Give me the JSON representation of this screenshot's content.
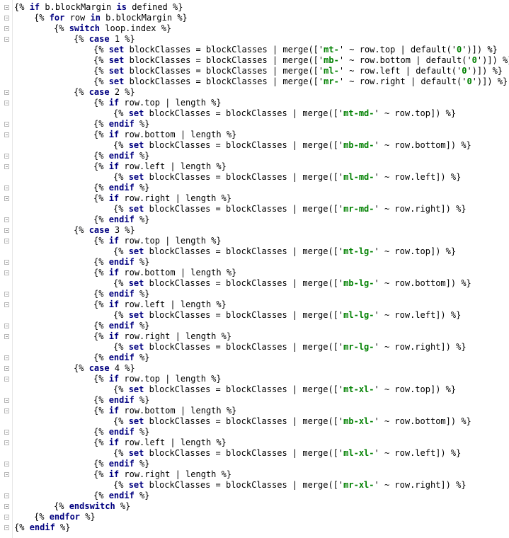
{
  "editor": {
    "lines": [
      {
        "indent": 0,
        "tokens": [
          {
            "t": "{% "
          },
          {
            "t": "if",
            "k": "kw"
          },
          {
            "t": " b.blockMargin "
          },
          {
            "t": "is",
            "k": "kw"
          },
          {
            "t": " defined %}"
          }
        ]
      },
      {
        "indent": 1,
        "tokens": [
          {
            "t": "{% "
          },
          {
            "t": "for",
            "k": "kw"
          },
          {
            "t": " row "
          },
          {
            "t": "in",
            "k": "kw"
          },
          {
            "t": " b.blockMargin %}"
          }
        ]
      },
      {
        "indent": 2,
        "tokens": [
          {
            "t": "{% "
          },
          {
            "t": "switch",
            "k": "kw"
          },
          {
            "t": " loop.index %}"
          }
        ]
      },
      {
        "indent": 3,
        "tokens": [
          {
            "t": "{% "
          },
          {
            "t": "case",
            "k": "kw"
          },
          {
            "t": " 1 %}"
          }
        ]
      },
      {
        "indent": 4,
        "tokens": [
          {
            "t": "{% "
          },
          {
            "t": "set",
            "k": "kw"
          },
          {
            "t": " blockClasses = blockClasses | merge(['"
          },
          {
            "t": "mt-",
            "k": "str"
          },
          {
            "t": "' ~ row.top | default('"
          },
          {
            "t": "0",
            "k": "str"
          },
          {
            "t": "')]) %}"
          }
        ]
      },
      {
        "indent": 4,
        "tokens": [
          {
            "t": "{% "
          },
          {
            "t": "set",
            "k": "kw"
          },
          {
            "t": " blockClasses = blockClasses | merge(['"
          },
          {
            "t": "mb-",
            "k": "str"
          },
          {
            "t": "' ~ row.bottom | default('"
          },
          {
            "t": "0",
            "k": "str"
          },
          {
            "t": "')]) %}"
          }
        ]
      },
      {
        "indent": 4,
        "tokens": [
          {
            "t": "{% "
          },
          {
            "t": "set",
            "k": "kw"
          },
          {
            "t": " blockClasses = blockClasses | merge(['"
          },
          {
            "t": "ml-",
            "k": "str"
          },
          {
            "t": "' ~ row.left | default('"
          },
          {
            "t": "0",
            "k": "str"
          },
          {
            "t": "')]) %}"
          }
        ]
      },
      {
        "indent": 4,
        "tokens": [
          {
            "t": "{% "
          },
          {
            "t": "set",
            "k": "kw"
          },
          {
            "t": " blockClasses = blockClasses | merge(['"
          },
          {
            "t": "mr-",
            "k": "str"
          },
          {
            "t": "' ~ row.right | default('"
          },
          {
            "t": "0",
            "k": "str"
          },
          {
            "t": "')]) %}"
          }
        ]
      },
      {
        "indent": 3,
        "tokens": [
          {
            "t": "{% "
          },
          {
            "t": "case",
            "k": "kw"
          },
          {
            "t": " 2 %}"
          }
        ]
      },
      {
        "indent": 4,
        "tokens": [
          {
            "t": "{% "
          },
          {
            "t": "if",
            "k": "kw"
          },
          {
            "t": " row.top | length %}"
          }
        ]
      },
      {
        "indent": 5,
        "tokens": [
          {
            "t": "{% "
          },
          {
            "t": "set",
            "k": "kw"
          },
          {
            "t": " blockClasses = blockClasses | merge(['"
          },
          {
            "t": "mt-md-",
            "k": "str"
          },
          {
            "t": "' ~ row.top]) %}"
          }
        ]
      },
      {
        "indent": 4,
        "tokens": [
          {
            "t": "{% "
          },
          {
            "t": "endif",
            "k": "kw"
          },
          {
            "t": " %}"
          }
        ]
      },
      {
        "indent": 4,
        "tokens": [
          {
            "t": "{% "
          },
          {
            "t": "if",
            "k": "kw"
          },
          {
            "t": " row.bottom | length %}"
          }
        ]
      },
      {
        "indent": 5,
        "tokens": [
          {
            "t": "{% "
          },
          {
            "t": "set",
            "k": "kw"
          },
          {
            "t": " blockClasses = blockClasses | merge(['"
          },
          {
            "t": "mb-md-",
            "k": "str"
          },
          {
            "t": "' ~ row.bottom]) %}"
          }
        ]
      },
      {
        "indent": 4,
        "tokens": [
          {
            "t": "{% "
          },
          {
            "t": "endif",
            "k": "kw"
          },
          {
            "t": " %}"
          }
        ]
      },
      {
        "indent": 4,
        "tokens": [
          {
            "t": "{% "
          },
          {
            "t": "if",
            "k": "kw"
          },
          {
            "t": " row.left | length %}"
          }
        ]
      },
      {
        "indent": 5,
        "tokens": [
          {
            "t": "{% "
          },
          {
            "t": "set",
            "k": "kw"
          },
          {
            "t": " blockClasses = blockClasses | merge(['"
          },
          {
            "t": "ml-md-",
            "k": "str"
          },
          {
            "t": "' ~ row.left]) %}"
          }
        ]
      },
      {
        "indent": 4,
        "tokens": [
          {
            "t": "{% "
          },
          {
            "t": "endif",
            "k": "kw"
          },
          {
            "t": " %}"
          }
        ]
      },
      {
        "indent": 4,
        "tokens": [
          {
            "t": "{% "
          },
          {
            "t": "if",
            "k": "kw"
          },
          {
            "t": " row.right | length %}"
          }
        ]
      },
      {
        "indent": 5,
        "tokens": [
          {
            "t": "{% "
          },
          {
            "t": "set",
            "k": "kw"
          },
          {
            "t": " blockClasses = blockClasses | merge(['"
          },
          {
            "t": "mr-md-",
            "k": "str"
          },
          {
            "t": "' ~ row.right]) %}"
          }
        ]
      },
      {
        "indent": 4,
        "tokens": [
          {
            "t": "{% "
          },
          {
            "t": "endif",
            "k": "kw"
          },
          {
            "t": " %}"
          }
        ]
      },
      {
        "indent": 3,
        "tokens": [
          {
            "t": "{% "
          },
          {
            "t": "case",
            "k": "kw"
          },
          {
            "t": " 3 %}"
          }
        ]
      },
      {
        "indent": 4,
        "tokens": [
          {
            "t": "{% "
          },
          {
            "t": "if",
            "k": "kw"
          },
          {
            "t": " row.top | length %}"
          }
        ]
      },
      {
        "indent": 5,
        "tokens": [
          {
            "t": "{% "
          },
          {
            "t": "set",
            "k": "kw"
          },
          {
            "t": " blockClasses = blockClasses | merge(['"
          },
          {
            "t": "mt-lg-",
            "k": "str"
          },
          {
            "t": "' ~ row.top]) %}"
          }
        ]
      },
      {
        "indent": 4,
        "tokens": [
          {
            "t": "{% "
          },
          {
            "t": "endif",
            "k": "kw"
          },
          {
            "t": " %}"
          }
        ]
      },
      {
        "indent": 4,
        "tokens": [
          {
            "t": "{% "
          },
          {
            "t": "if",
            "k": "kw"
          },
          {
            "t": " row.bottom | length %}"
          }
        ]
      },
      {
        "indent": 5,
        "tokens": [
          {
            "t": "{% "
          },
          {
            "t": "set",
            "k": "kw"
          },
          {
            "t": " blockClasses = blockClasses | merge(['"
          },
          {
            "t": "mb-lg-",
            "k": "str"
          },
          {
            "t": "' ~ row.bottom]) %}"
          }
        ]
      },
      {
        "indent": 4,
        "tokens": [
          {
            "t": "{% "
          },
          {
            "t": "endif",
            "k": "kw"
          },
          {
            "t": " %}"
          }
        ]
      },
      {
        "indent": 4,
        "tokens": [
          {
            "t": "{% "
          },
          {
            "t": "if",
            "k": "kw"
          },
          {
            "t": " row.left | length %}"
          }
        ]
      },
      {
        "indent": 5,
        "tokens": [
          {
            "t": "{% "
          },
          {
            "t": "set",
            "k": "kw"
          },
          {
            "t": " blockClasses = blockClasses | merge(['"
          },
          {
            "t": "ml-lg-",
            "k": "str"
          },
          {
            "t": "' ~ row.left]) %}"
          }
        ]
      },
      {
        "indent": 4,
        "tokens": [
          {
            "t": "{% "
          },
          {
            "t": "endif",
            "k": "kw"
          },
          {
            "t": " %}"
          }
        ]
      },
      {
        "indent": 4,
        "tokens": [
          {
            "t": "{% "
          },
          {
            "t": "if",
            "k": "kw"
          },
          {
            "t": " row.right | length %}"
          }
        ]
      },
      {
        "indent": 5,
        "tokens": [
          {
            "t": "{% "
          },
          {
            "t": "set",
            "k": "kw"
          },
          {
            "t": " blockClasses = blockClasses | merge(['"
          },
          {
            "t": "mr-lg-",
            "k": "str"
          },
          {
            "t": "' ~ row.right]) %}"
          }
        ]
      },
      {
        "indent": 4,
        "tokens": [
          {
            "t": "{% "
          },
          {
            "t": "endif",
            "k": "kw"
          },
          {
            "t": " %}"
          }
        ]
      },
      {
        "indent": 3,
        "tokens": [
          {
            "t": "{% "
          },
          {
            "t": "case",
            "k": "kw"
          },
          {
            "t": " 4 %}"
          }
        ]
      },
      {
        "indent": 4,
        "tokens": [
          {
            "t": "{% "
          },
          {
            "t": "if",
            "k": "kw"
          },
          {
            "t": " row.top | length %}"
          }
        ]
      },
      {
        "indent": 5,
        "tokens": [
          {
            "t": "{% "
          },
          {
            "t": "set",
            "k": "kw"
          },
          {
            "t": " blockClasses = blockClasses | merge(['"
          },
          {
            "t": "mt-xl-",
            "k": "str"
          },
          {
            "t": "' ~ row.top]) %}"
          }
        ]
      },
      {
        "indent": 4,
        "tokens": [
          {
            "t": "{% "
          },
          {
            "t": "endif",
            "k": "kw"
          },
          {
            "t": " %}"
          }
        ]
      },
      {
        "indent": 4,
        "tokens": [
          {
            "t": "{% "
          },
          {
            "t": "if",
            "k": "kw"
          },
          {
            "t": " row.bottom | length %}"
          }
        ]
      },
      {
        "indent": 5,
        "tokens": [
          {
            "t": "{% "
          },
          {
            "t": "set",
            "k": "kw"
          },
          {
            "t": " blockClasses = blockClasses | merge(['"
          },
          {
            "t": "mb-xl-",
            "k": "str"
          },
          {
            "t": "' ~ row.bottom]) %}"
          }
        ]
      },
      {
        "indent": 4,
        "tokens": [
          {
            "t": "{% "
          },
          {
            "t": "endif",
            "k": "kw"
          },
          {
            "t": " %}"
          }
        ]
      },
      {
        "indent": 4,
        "tokens": [
          {
            "t": "{% "
          },
          {
            "t": "if",
            "k": "kw"
          },
          {
            "t": " row.left | length %}"
          }
        ]
      },
      {
        "indent": 5,
        "tokens": [
          {
            "t": "{% "
          },
          {
            "t": "set",
            "k": "kw"
          },
          {
            "t": " blockClasses = blockClasses | merge(['"
          },
          {
            "t": "ml-xl-",
            "k": "str"
          },
          {
            "t": "' ~ row.left]) %}"
          }
        ]
      },
      {
        "indent": 4,
        "tokens": [
          {
            "t": "{% "
          },
          {
            "t": "endif",
            "k": "kw"
          },
          {
            "t": " %}"
          }
        ]
      },
      {
        "indent": 4,
        "tokens": [
          {
            "t": "{% "
          },
          {
            "t": "if",
            "k": "kw"
          },
          {
            "t": " row.right | length %}"
          }
        ]
      },
      {
        "indent": 5,
        "tokens": [
          {
            "t": "{% "
          },
          {
            "t": "set",
            "k": "kw"
          },
          {
            "t": " blockClasses = blockClasses | merge(['"
          },
          {
            "t": "mr-xl-",
            "k": "str"
          },
          {
            "t": "' ~ row.right]) %}"
          }
        ]
      },
      {
        "indent": 4,
        "tokens": [
          {
            "t": "{% "
          },
          {
            "t": "endif",
            "k": "kw"
          },
          {
            "t": " %}"
          }
        ]
      },
      {
        "indent": 2,
        "tokens": [
          {
            "t": "{% "
          },
          {
            "t": "endswitch",
            "k": "kw"
          },
          {
            "t": " %}"
          }
        ]
      },
      {
        "indent": 1,
        "tokens": [
          {
            "t": "{% "
          },
          {
            "t": "endfor",
            "k": "kw"
          },
          {
            "t": " %}"
          }
        ]
      },
      {
        "indent": 0,
        "tokens": [
          {
            "t": "{% "
          },
          {
            "t": "endif",
            "k": "kw"
          },
          {
            "t": " %}"
          }
        ]
      }
    ],
    "colors": {
      "keyword": "#000080",
      "string": "#008000",
      "text": "#000000",
      "background": "#ffffff"
    }
  }
}
